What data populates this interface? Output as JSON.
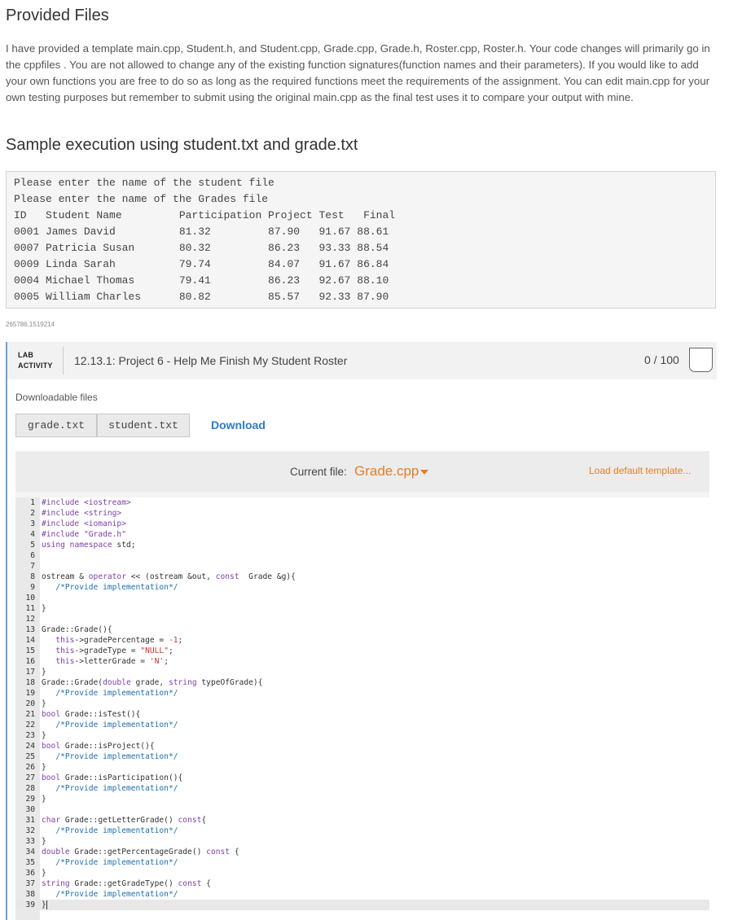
{
  "provided_files": {
    "heading": "Provided Files",
    "paragraph": "I have provided a template main.cpp, Student.h, and Student.cpp, Grade.cpp, Grade.h, Roster.cpp, Roster.h. Your code changes will primarily go in the cppfiles . You are not allowed to change any of the existing function signatures(function names and their parameters). If you would like to add your own functions you are free to do so as long as the required functions meet the requirements of the assignment. You can edit main.cpp for your own testing purposes but remember to submit using the original main.cpp as the final test uses it to compare your output with mine."
  },
  "sample": {
    "heading": "Sample execution using student.txt and grade.txt",
    "lines": [
      "Please enter the name of the student file",
      "Please enter the name of the Grades file",
      "ID   Student Name         Participation Project Test   Final",
      "0001 James David          81.32         87.90   91.67 88.61",
      "0007 Patricia Susan       80.32         86.23   93.33 88.54",
      "0009 Linda Sarah          79.74         84.07   91.67 86.84",
      "0004 Michael Thomas       79.41         86.23   92.67 88.10",
      "0005 William Charles      80.82         85.57   92.33 87.90"
    ]
  },
  "meta_id": "265786.1519214",
  "lab": {
    "type_line1": "LAB",
    "type_line2": "ACTIVITY",
    "title": "12.13.1: Project 6 - Help Me Finish My Student Roster",
    "score": "0 / 100",
    "downloadable_label": "Downloadable files",
    "files": [
      "grade.txt",
      "student.txt"
    ],
    "download_label": "Download",
    "current_file_label": "Current file:",
    "current_file": "Grade.cpp",
    "load_default_label": "Load default template...",
    "accent_color": "#e67e22",
    "link_color": "#2e7cc7"
  },
  "code": [
    "#include <iostream>",
    "#include <string>",
    "#include <iomanip>",
    "#include \"Grade.h\"",
    "using namespace std;",
    "",
    "",
    "ostream & operator << (ostream &out, const  Grade &g){",
    "   /*Provide implementation*/",
    "",
    "}",
    "",
    "Grade::Grade(){",
    "   this->gradePercentage = -1;",
    "   this->gradeType = \"NULL\";",
    "   this->letterGrade = 'N';",
    "}",
    "Grade::Grade(double grade, string typeOfGrade){",
    "   /*Provide implementation*/",
    "}",
    "bool Grade::isTest(){",
    "   /*Provide implementation*/",
    "}",
    "bool Grade::isProject(){",
    "   /*Provide implementation*/",
    "}",
    "bool Grade::isParticipation(){",
    "   /*Provide implementation*/",
    "}",
    "",
    "char Grade::getLetterGrade() const{",
    "   /*Provide implementation*/",
    "}",
    "double Grade::getPercentageGrade() const {",
    "   /*Provide implementation*/",
    "}",
    "string Grade::getGradeType() const {",
    "   /*Provide implementation*/",
    "}"
  ]
}
